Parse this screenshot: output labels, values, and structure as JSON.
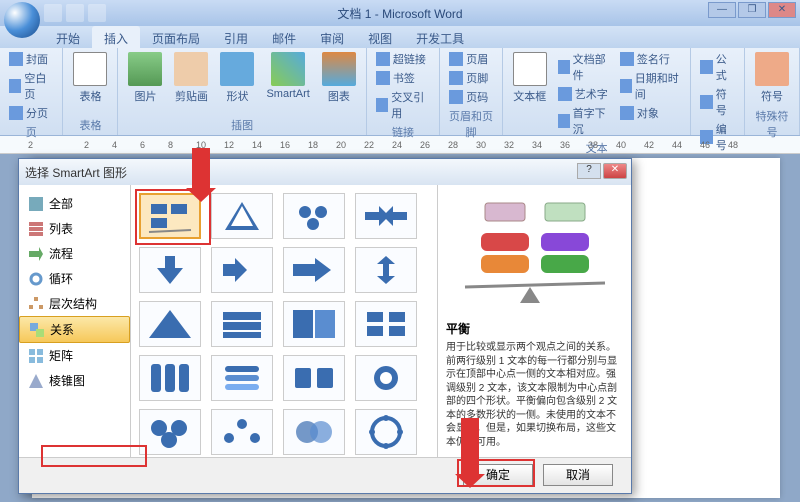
{
  "window": {
    "title": "文档 1 - Microsoft Word"
  },
  "tabs": [
    "开始",
    "插入",
    "页面布局",
    "引用",
    "邮件",
    "审阅",
    "视图",
    "开发工具"
  ],
  "active_tab": 1,
  "ribbon": {
    "g1": {
      "label": "页",
      "items": [
        "封面",
        "空白页",
        "分页"
      ]
    },
    "g2": {
      "label": "表格",
      "btn": "表格"
    },
    "g3": {
      "label": "插图",
      "items": [
        "图片",
        "剪贴画",
        "形状",
        "SmartArt",
        "图表"
      ]
    },
    "g4": {
      "label": "链接",
      "items": [
        "超链接",
        "书签",
        "交叉引用"
      ]
    },
    "g5": {
      "label": "页眉和页脚",
      "items": [
        "页眉",
        "页脚",
        "页码"
      ]
    },
    "g6": {
      "label": "文本",
      "btn": "文本框",
      "items": [
        "文档部件",
        "艺术字",
        "首字下沉",
        "签名行",
        "日期和时间",
        "对象"
      ]
    },
    "g7": {
      "label": "符号",
      "items": [
        "公式",
        "符号",
        "编号"
      ]
    },
    "g8": {
      "label": "特殊符号",
      "btn": "符号"
    }
  },
  "ruler": [
    "2",
    "",
    "2",
    "4",
    "6",
    "8",
    "10",
    "12",
    "14",
    "16",
    "18",
    "20",
    "22",
    "24",
    "26",
    "28",
    "30",
    "32",
    "34",
    "36",
    "38",
    "40",
    "42",
    "44",
    "46",
    "48"
  ],
  "dialog": {
    "title": "选择 SmartArt 图形",
    "categories": [
      "全部",
      "列表",
      "流程",
      "循环",
      "层次结构",
      "关系",
      "矩阵",
      "棱锥图"
    ],
    "selected_category": 5,
    "preview": {
      "title": "平衡",
      "desc": "用于比较或显示两个观点之间的关系。前两行级别 1 文本的每一行都分别与显示在顶部中心点一侧的文本相对应。强调级别 2 文本，该文本限制为中心点剖部的四个形状。平衡偏向包含级别 2 文本的多数形状的一侧。未使用的文本不会显示，但是，如果切换布局，这些文本仍将可用。"
    },
    "ok": "确定",
    "cancel": "取消"
  }
}
